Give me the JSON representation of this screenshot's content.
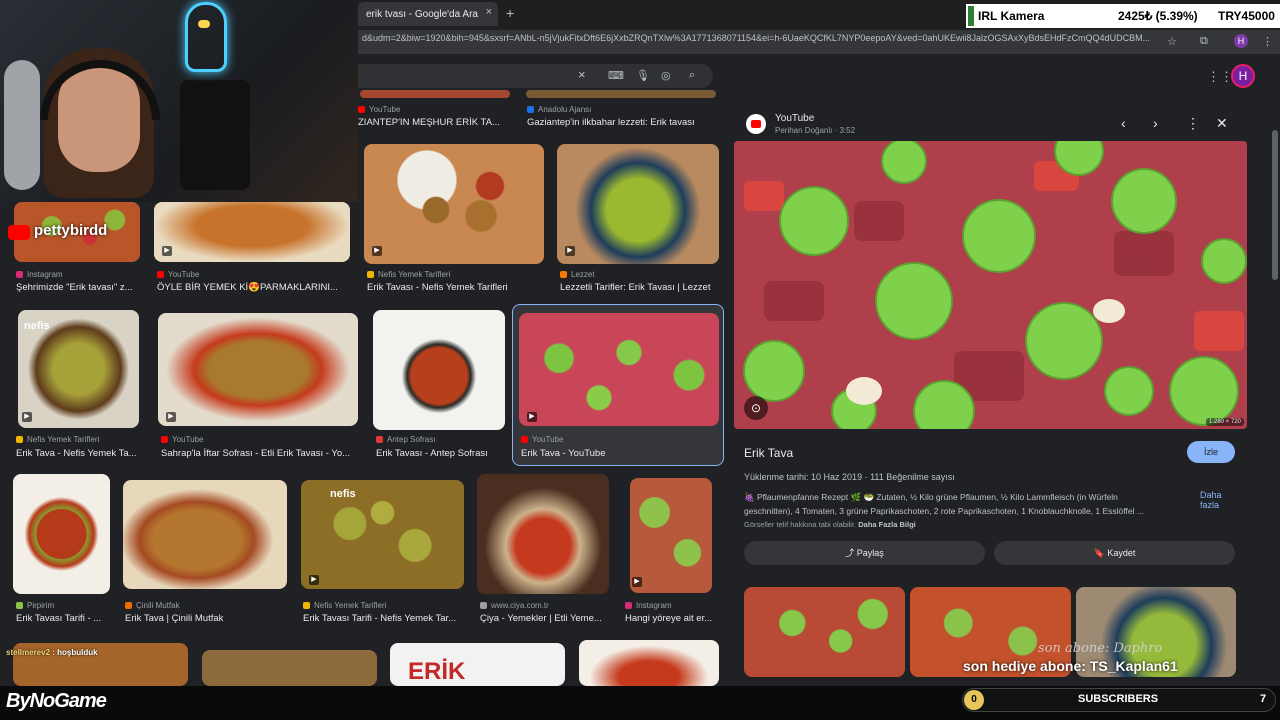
{
  "browser": {
    "tab_title": "erik tvası - Google'da Ara",
    "tab_close": "×",
    "new_tab": "+",
    "url": "d&udm=2&biw=1920&bih=945&sxsrf=ANbL-n5jVjukFitxDft6E6jXxbZRQnTXlw%3A1771368071154&ei=h-6UaeKQCfKL7NYP0eepoAY&ved=0ahUKEwii8JalzOGSAxXyBdsEHdFzCmQQ4dUDCBM...",
    "profile_letter": "H"
  },
  "search": {
    "clear": "×",
    "avatar_letter": "H"
  },
  "ticker": {
    "label": "IRL Kamera",
    "value": "2425₺ (5.39%)",
    "goal": "TRY45000",
    "accent": "#2e7d32"
  },
  "grid": {
    "row0": [
      {
        "source": "YouTube",
        "title": "ZIANTEP'IN MEŞHUR ERİK TA..."
      },
      {
        "source": "Anadolu Ajansı",
        "title": "Gaziantep'in ilkbahar lezzeti: Erik tavası"
      }
    ],
    "row1": [
      {
        "source": "Instagram",
        "title": "Şehrimizde \"Erik tavası\" z..."
      },
      {
        "source": "YouTube",
        "title": "ÖYLE BİR YEMEK Kİ😍PARMAKLARINI..."
      },
      {
        "source": "Nefis Yemek Tarifleri",
        "title": "Erik Tavası - Nefis Yemek Tarifleri"
      },
      {
        "source": "Lezzet",
        "title": "Lezzetli Tarifler: Erik Tavası | Lezzet"
      }
    ],
    "row2": [
      {
        "source": "Nefis Yemek Tarifleri",
        "title": "Erik Tava - Nefis Yemek Ta..."
      },
      {
        "source": "YouTube",
        "title": "Sahrap'la İftar Sofrası - Etli Erik Tavası - Yo..."
      },
      {
        "source": "Antep Sofrası",
        "title": "Erik Tavası - Antep Sofrası"
      },
      {
        "source": "YouTube",
        "title": "Erik Tava - YouTube"
      }
    ],
    "row3": [
      {
        "source": "Pirpirim",
        "title": "Erik Tavası Tarifi - ..."
      },
      {
        "source": "Çinili Mutfak",
        "title": "Erik Tava | Çinili Mutfak"
      },
      {
        "source": "Nefis Yemek Tarifleri",
        "title": "Erik Tavası Tarifi - Nefis Yemek Tar..."
      },
      {
        "source": "www.ciya.com.tr",
        "title": "Çiya - Yemekler | Etli Yeme..."
      },
      {
        "source": "Instagram",
        "title": "Hangi yöreye ait er..."
      }
    ],
    "erik_badge": "ERİK",
    "nefis_badge": "nefis"
  },
  "panel": {
    "source": "YouTube",
    "channel": "Perihan Doğanlı",
    "duration": "3:52",
    "dims": "1.280 × 720",
    "title": "Erik Tava",
    "watch": "İzle",
    "meta": "Yüklenme tarihi: 10 Haz 2019 · 111 Beğenilme sayısı",
    "desc1": "🍇 Pflaumenpfanne Rezept 🌿 🥗 Zutaten, ½ Kilo grüne Pflaumen, ½ Kilo Lammfleisch (in Würfeln",
    "desc2": "geschnitten), 4 Tomaten, 3 grüne Paprikaschoten, 2 rote Paprikaschoten, 1 Knoblauchknolle, 1 Esslöffel ...",
    "more": "Daha fazla",
    "notice": "Görseller telif hakkına tabi olabilir.",
    "notice_link": "Daha Fazla Bilgi",
    "share": "Paylaş",
    "save": "Kaydet"
  },
  "stream": {
    "brand": "ByNoGame",
    "subs_label": "SUBSCRIBERS",
    "subs_count": "0",
    "subs_total": "7",
    "chat_user": "stellmerev2 :",
    "chat_msg": "hoşbulduk",
    "overlay1": "son abone: Daphro",
    "overlay2": "son hediye abone: TS_Kaplan61",
    "petty": "pettybirdd"
  }
}
